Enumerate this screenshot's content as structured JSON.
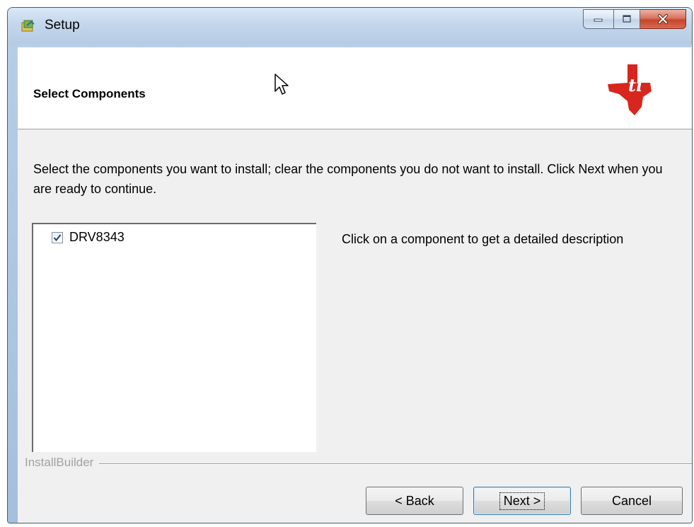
{
  "window": {
    "title": "Setup",
    "caption_buttons": {
      "minimize_icon": "minimize-icon",
      "maximize_icon": "maximize-icon",
      "close_icon": "close-x-icon"
    }
  },
  "header": {
    "title": "Select Components",
    "logo": "texas-instruments-logo"
  },
  "instructions": "Select the components you want to install; clear the components you do not want to install. Click Next when you are ready to continue.",
  "components": [
    {
      "label": "DRV8343",
      "checked": true
    }
  ],
  "description": "Click on a component to get a detailed description",
  "footer": {
    "brand": "InstallBuilder"
  },
  "buttons": {
    "back": "< Back",
    "next": "Next >",
    "cancel": "Cancel"
  },
  "colors": {
    "logo_red": "#d7261e",
    "client_bg": "#f0f0f0",
    "close_button": "#c5452d"
  }
}
